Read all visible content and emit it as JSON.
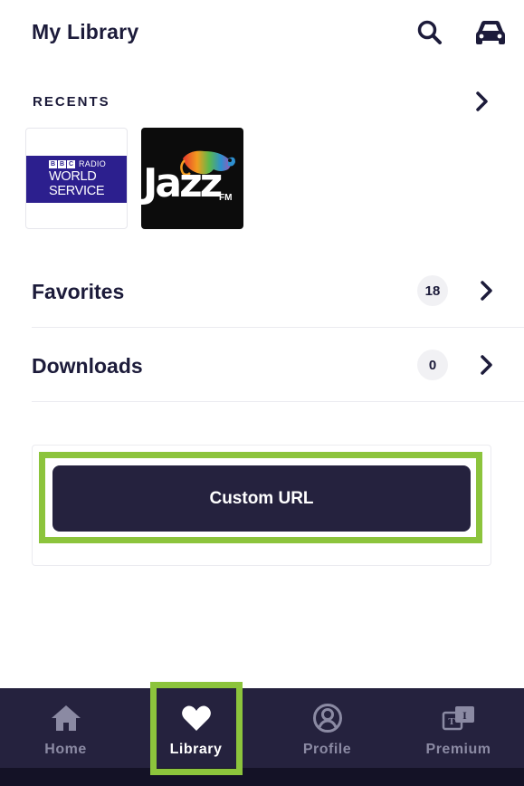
{
  "header": {
    "title": "My Library",
    "search_icon": "search-icon",
    "car_icon": "car-mode-icon"
  },
  "recents": {
    "label": "RECENTS",
    "stations": [
      {
        "name": "BBC Radio World Service",
        "logo_top": "RADIO",
        "logo_line1": "WORLD",
        "logo_line2": "SERVICE",
        "bbc_letters": [
          "B",
          "B",
          "C"
        ]
      },
      {
        "name": "Jazz FM",
        "logo_word": "Jazz",
        "logo_suffix": "FM"
      }
    ]
  },
  "rows": {
    "favorites": {
      "label": "Favorites",
      "count": "18"
    },
    "downloads": {
      "label": "Downloads",
      "count": "0"
    }
  },
  "custom_url": {
    "label": "Custom URL"
  },
  "nav": {
    "items": [
      {
        "label": "Home",
        "icon": "home-icon",
        "active": false
      },
      {
        "label": "Library",
        "icon": "heart-icon",
        "active": true
      },
      {
        "label": "Profile",
        "icon": "profile-icon",
        "active": false
      },
      {
        "label": "Premium",
        "icon": "premium-icon",
        "active": false
      }
    ]
  },
  "colors": {
    "text": "#1c1b3a",
    "nav_bg": "#25223e",
    "button_bg": "#25223e",
    "highlight": "#8cc43c",
    "bbc_blue": "#2c1f8e",
    "nav_inactive": "#8b8aa3"
  }
}
